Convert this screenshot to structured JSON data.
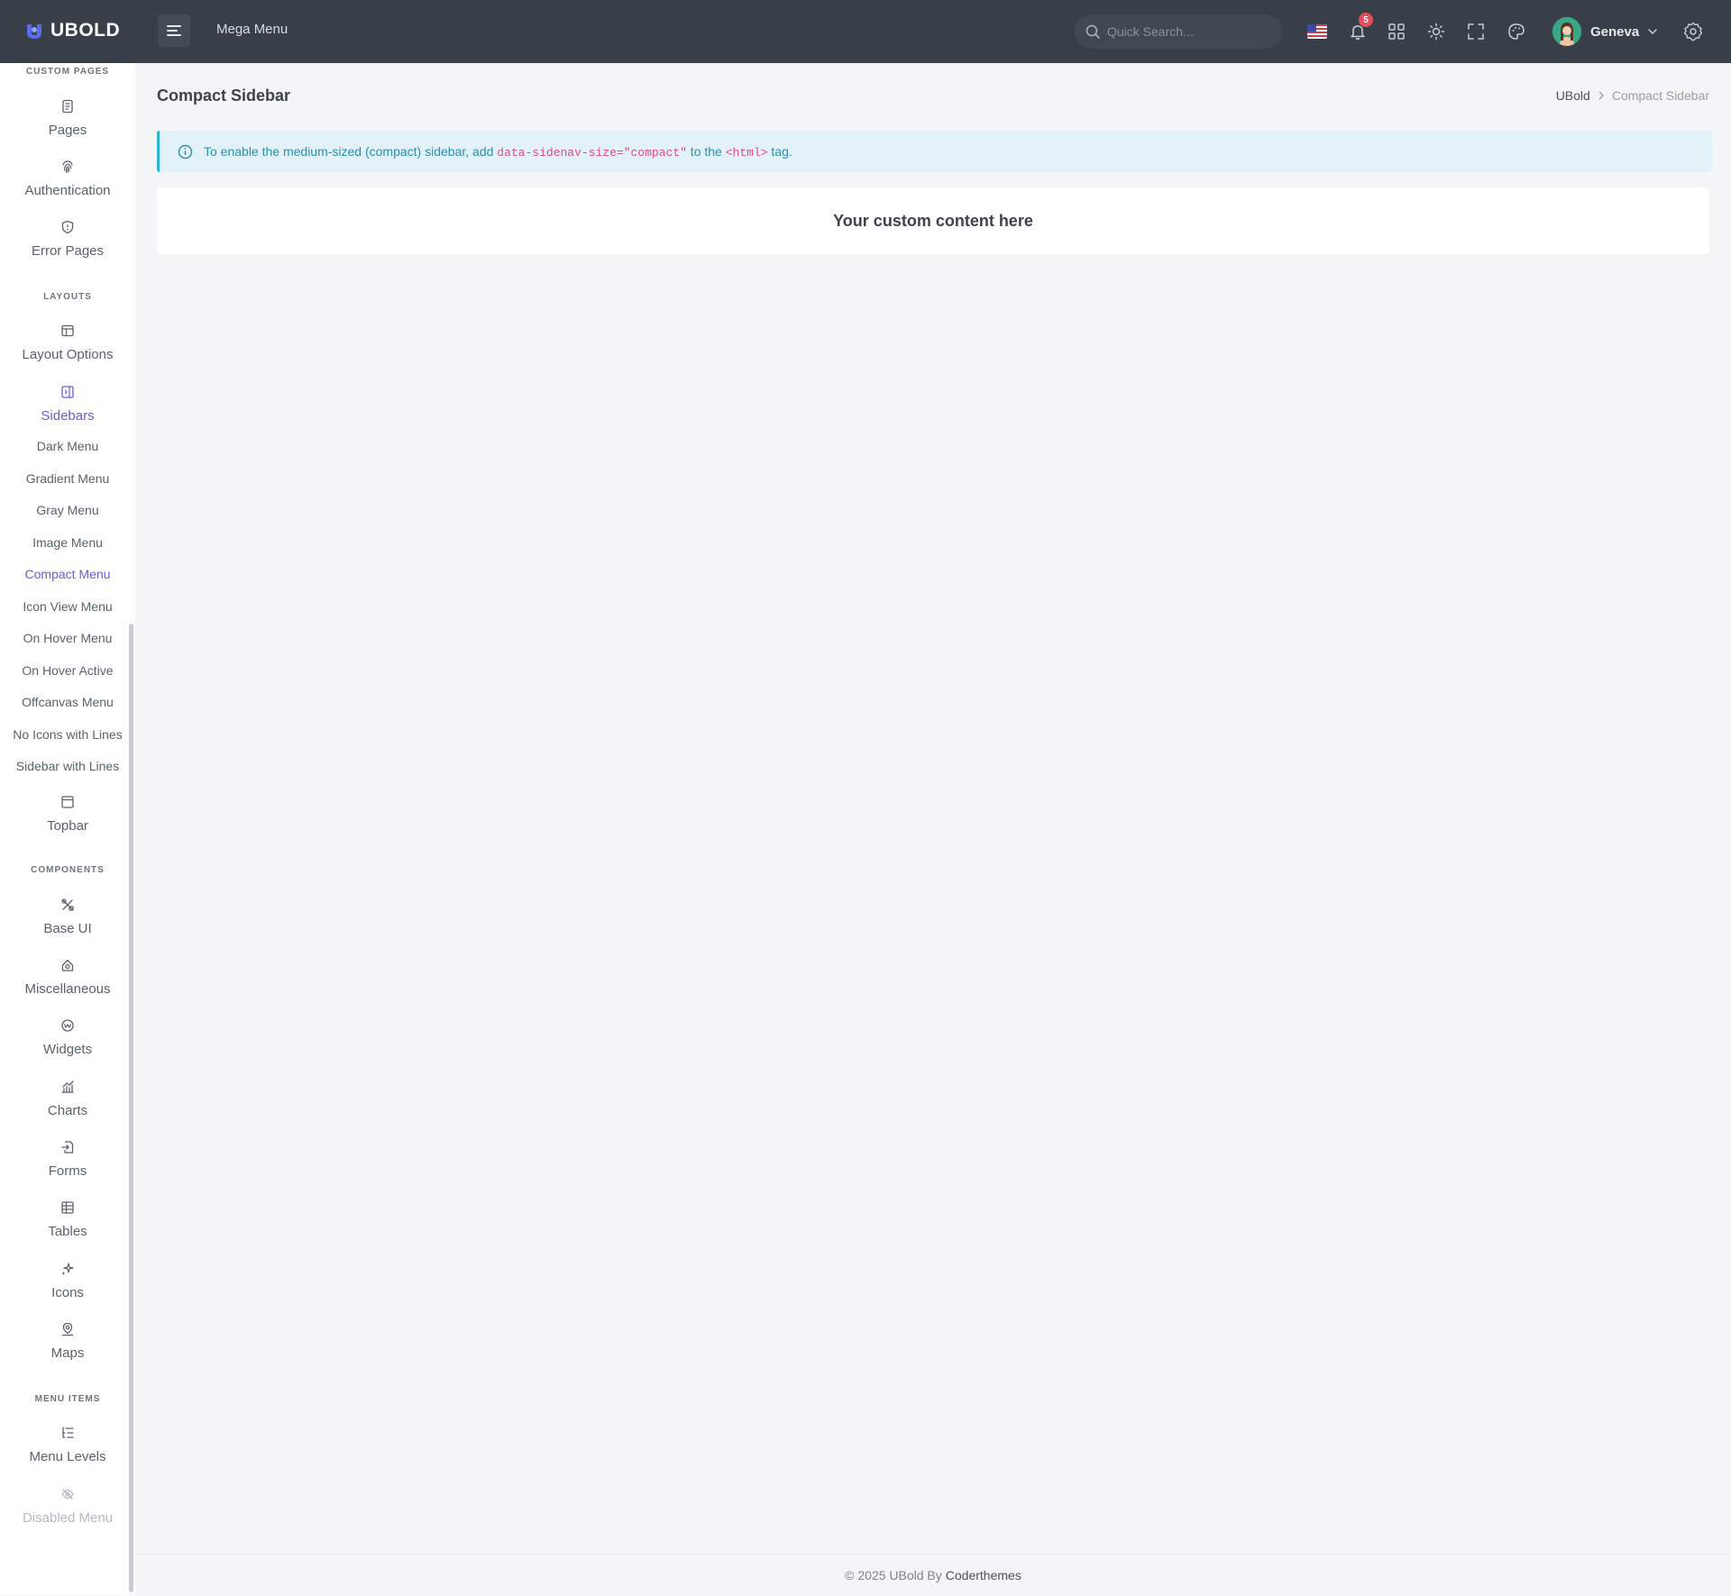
{
  "topbar": {
    "brand": "UBOLD",
    "mega_menu": "Mega Menu",
    "search_placeholder": "Quick Search...",
    "notification_count": "5",
    "user_name": "Geneva"
  },
  "sidebar": {
    "custom_pages_title": "Custom Pages",
    "pages": "Pages",
    "authentication": "Authentication",
    "error_pages": "Error Pages",
    "layouts_title": "Layouts",
    "layout_options": "Layout Options",
    "sidebars": "Sidebars",
    "sidebars_sub": [
      "Dark Menu",
      "Gradient Menu",
      "Gray Menu",
      "Image Menu",
      "Compact Menu",
      "Icon View Menu",
      "On Hover Menu",
      "On Hover Active",
      "Offcanvas Menu",
      "No Icons with Lines",
      "Sidebar with Lines"
    ],
    "topbar": "Topbar",
    "components_title": "Components",
    "base_ui": "Base UI",
    "miscellaneous": "Miscellaneous",
    "widgets": "Widgets",
    "charts": "Charts",
    "forms": "Forms",
    "tables": "Tables",
    "icons": "Icons",
    "maps": "Maps",
    "menu_items_title": "Menu Items",
    "menu_levels": "Menu Levels",
    "disabled_menu": "Disabled Menu"
  },
  "page": {
    "title": "Compact Sidebar",
    "breadcrumb_home": "UBold",
    "breadcrumb_current": "Compact Sidebar",
    "alert_pre": "To enable the medium-sized (compact) sidebar, add ",
    "alert_code1": "data-sidenav-size=\"compact\"",
    "alert_mid": " to the ",
    "alert_code2": "<html>",
    "alert_post": " tag.",
    "card_title": "Your custom content here"
  },
  "footer": {
    "text": "© 2025 UBold By",
    "link": "Coderthemes"
  },
  "colors": {
    "topbar_bg": "#383f48",
    "accent": "#6e5bd8",
    "alert_bg": "#e2f2f8",
    "badge": "#e54c5c"
  }
}
